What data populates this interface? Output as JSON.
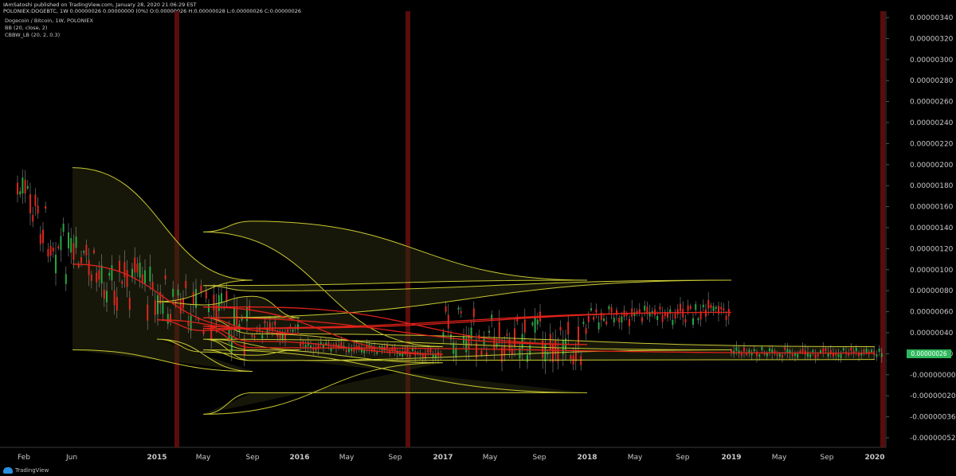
{
  "header": {
    "line1": "IAmSatoshi published on TradingView.com, January 28, 2020 21:06:29 EST",
    "line2": "POLONIEX:DOGEBTC, 1W  0.00000026 0.00000000 (0%) O:0.00000026 H:0.00000028 L:0.00000026 C:0.00000026"
  },
  "legend": [
    "Dogecoin / Bitcoin, 1W, POLONIEX",
    "BB (20, close, 2)",
    "CBBW_LB (20, 2, 0.3)"
  ],
  "price_tag": "0.00000026",
  "footer": {
    "brand": "TradingView"
  },
  "colors": {
    "background": "#000000",
    "up_candle": "#26a641",
    "down_candle": "#d9281f",
    "bb_band": "#c8c832",
    "bb_fill": "#2a2a10",
    "bb_basis": "#e0221a",
    "squeeze_bar": "#5a0c0c",
    "axis_text": "#c8c8c8"
  },
  "chart_data": {
    "type": "line",
    "x_labels": [
      "Feb",
      "Jun",
      "2015",
      "May",
      "Sep",
      "2016",
      "May",
      "Sep",
      "2017",
      "May",
      "Sep",
      "2018",
      "May",
      "Sep",
      "2019",
      "May",
      "Sep",
      "2020"
    ],
    "y_tick_labels": [
      "0.00000340",
      "0.00000320",
      "0.00000300",
      "0.00000280",
      "0.00000260",
      "0.00000240",
      "0.00000220",
      "0.00000200",
      "0.00000180",
      "0.00000160",
      "0.00000140",
      "0.00000120",
      "0.00000100",
      "0.00000080",
      "0.00000060",
      "0.00000040",
      "0.00000020",
      "-0.00000000",
      "-0.00000020",
      "-0.00000036",
      "-0.00000052"
    ],
    "ylim": [
      -5.2e-07,
      3.4e-06
    ],
    "last_price": 2.6e-07,
    "squeeze_markers": [
      "early 2015",
      "late 2016",
      "early 2020"
    ],
    "series": [
      {
        "name": "BB upper",
        "points": [
          [
            "Jun",
            2e-06
          ],
          [
            "Sep",
            9.5e-07
          ],
          [
            "2015",
            7.5e-07
          ],
          [
            "May",
            7.2e-07
          ],
          [
            "Sep",
            8e-07
          ],
          [
            "2016",
            6e-07
          ],
          [
            "May",
            6e-07
          ],
          [
            "Sep",
            4.5e-07
          ],
          [
            "2017",
            3.3e-07
          ],
          [
            "May",
            1.4e-06
          ],
          [
            "Sep",
            1.5e-06
          ],
          [
            "2018",
            9.5e-07
          ],
          [
            "May",
            9e-07
          ],
          [
            "Sep",
            8.5e-07
          ],
          [
            "2019",
            9.5e-07
          ],
          [
            "May",
            6e-07
          ],
          [
            "Sep",
            4.5e-07
          ],
          [
            "2020",
            3.3e-07
          ]
        ]
      },
      {
        "name": "BB basis",
        "points": [
          [
            "Jun",
            1.1e-06
          ],
          [
            "Sep",
            5e-07
          ],
          [
            "2015",
            5.8e-07
          ],
          [
            "May",
            4.8e-07
          ],
          [
            "Sep",
            5e-07
          ],
          [
            "2016",
            4.5e-07
          ],
          [
            "May",
            5.2e-07
          ],
          [
            "Sep",
            3.8e-07
          ],
          [
            "2017",
            2.6e-07
          ],
          [
            "May",
            7e-07
          ],
          [
            "Sep",
            7e-07
          ],
          [
            "2018",
            3.5e-07
          ],
          [
            "May",
            6e-07
          ],
          [
            "Sep",
            5e-07
          ],
          [
            "2019",
            6.5e-07
          ],
          [
            "May",
            5e-07
          ],
          [
            "Sep",
            3.2e-07
          ],
          [
            "2020",
            2.7e-07
          ]
        ]
      },
      {
        "name": "BB lower",
        "points": [
          [
            "Jun",
            3e-07
          ],
          [
            "Sep",
            1e-07
          ],
          [
            "2015",
            4e-07
          ],
          [
            "May",
            2.8e-07
          ],
          [
            "Sep",
            2.5e-07
          ],
          [
            "2016",
            3e-07
          ],
          [
            "May",
            4e-07
          ],
          [
            "Sep",
            3e-07
          ],
          [
            "2017",
            1.8e-07
          ],
          [
            "May",
            -3e-07
          ],
          [
            "Sep",
            -1e-07
          ],
          [
            "2018",
            -1e-07
          ],
          [
            "May",
            3e-07
          ],
          [
            "Sep",
            2e-07
          ],
          [
            "2019",
            3e-07
          ],
          [
            "May",
            4e-07
          ],
          [
            "Sep",
            2e-07
          ],
          [
            "2020",
            2.1e-07
          ]
        ]
      }
    ]
  }
}
